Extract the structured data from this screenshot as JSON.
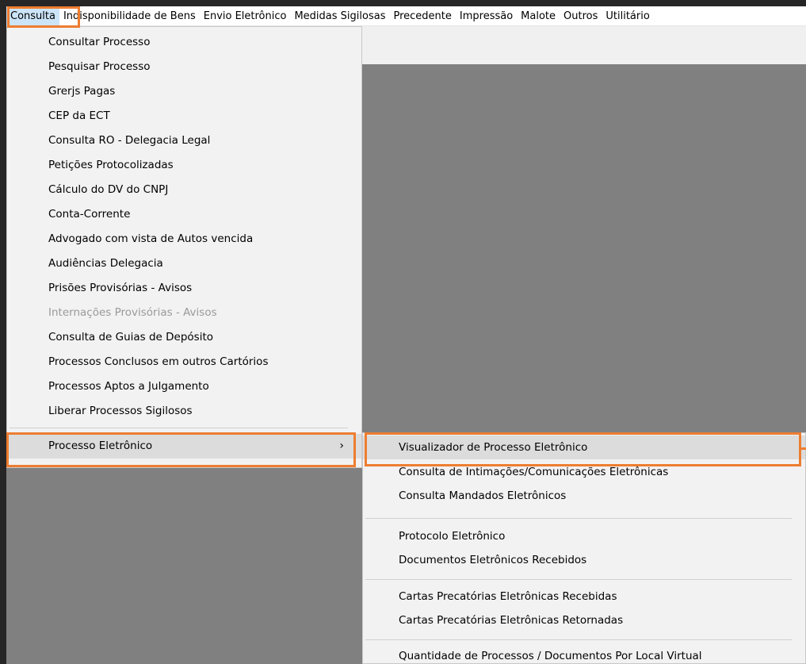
{
  "menubar": {
    "items": [
      "Consulta",
      "Indisponibilidade de Bens",
      "Envio Eletrônico",
      "Medidas Sigilosas",
      "Precedente",
      "Impressão",
      "Malote",
      "Outros",
      "Utilitário"
    ]
  },
  "consulta_menu": {
    "items": [
      "Consultar Processo",
      "Pesquisar Processo",
      "Grerjs Pagas",
      "CEP da ECT",
      "Consulta RO - Delegacia Legal",
      "Petições Protocolizadas",
      "Cálculo do DV do CNPJ",
      "Conta-Corrente",
      "Advogado com vista de Autos vencida",
      "Audiências Delegacia",
      "Prisões Provisórias - Avisos",
      "Internações Provisórias - Avisos",
      "Consulta de Guias de Depósito",
      "Processos Conclusos em outros Cartórios",
      "Processos Aptos a Julgamento",
      "Liberar Processos Sigilosos",
      "Processo Eletrônico"
    ],
    "submenu_arrow": "›"
  },
  "processo_eletronico_menu": {
    "items": [
      "Visualizador de Processo Eletrônico",
      "Consulta de Intimações/Comunicações Eletrônicas",
      "Consulta Mandados Eletrônicos",
      "Protocolo Eletrônico",
      "Documentos Eletrônicos Recebidos",
      "Cartas Precatórias Eletrônicas Recebidas",
      "Cartas Precatórias Eletrônicas Retornadas",
      "Quantidade de Processos / Documentos Por Local Virtual"
    ]
  },
  "colors": {
    "highlight_outline": "#ed7d31",
    "menubar_active": "#cce4f7",
    "workspace": "#808080",
    "menu_bg": "#f2f2f2"
  }
}
